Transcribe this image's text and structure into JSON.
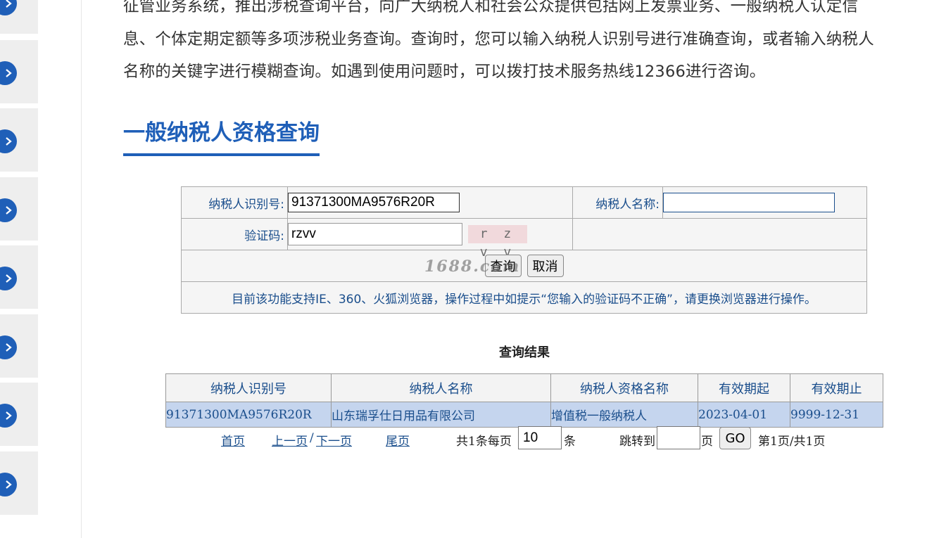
{
  "intro": {
    "line1": "征管业务系统，推出涉税查询平台，向广大纳税人和社会公众提供包括网上发票业务、一般纳税人认定信",
    "line2": "息、个体定期定额等多项涉税业务查询。查询时，您可以输入纳税人识别号进行准确查询，或者输入纳税人",
    "line3": "名称的关键字进行模糊查询。如遇到使用问题时，可以拨打技术服务热线12366进行咨询。"
  },
  "section_title": "一般纳税人资格查询",
  "form": {
    "taxpayer_id_label": "纳税人识别号:",
    "taxpayer_id_value": "91371300MA9576R20R",
    "taxpayer_name_label": "纳税人名称:",
    "taxpayer_name_value": "",
    "captcha_label": "验证码:",
    "captcha_value": "rzvv",
    "captcha_image_text": "r z v v",
    "query_button": "查询",
    "cancel_button": "取消",
    "watermark": "1688.com",
    "notice": "目前该功能支持IE、360、火狐浏览器，操作过程中如提示“您输入的验证码不正确”，请更换浏览器进行操作。"
  },
  "results": {
    "title": "查询结果",
    "columns": [
      "纳税人识别号",
      "纳税人名称",
      "纳税人资格名称",
      "有效期起",
      "有效期止"
    ],
    "rows": [
      [
        "91371300MA9576R20R",
        "山东瑞孚仕日用品有限公司",
        "增值税一般纳税人",
        "2023-04-01",
        "9999-12-31"
      ]
    ]
  },
  "pager": {
    "first": "首页",
    "prev": "上一页",
    "sep": "/",
    "next": "下一页",
    "last": "尾页",
    "total_prefix": "共1条每页",
    "page_size": "10",
    "unit": "条",
    "jump_label": "跳转到",
    "jump_value": "",
    "page_unit": "页",
    "go": "GO",
    "page_status": "第1页/共1页"
  },
  "colors": {
    "brand_blue": "#1f5fb8",
    "text_blue": "#1a4e8c",
    "row_highlight": "#c5d5ee"
  },
  "icons": {
    "sidebar_arrow": "chevron-right-icon"
  }
}
